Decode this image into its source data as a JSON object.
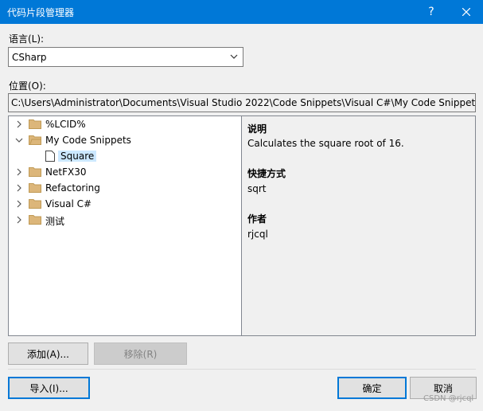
{
  "window": {
    "title": "代码片段管理器",
    "help_glyph": "?",
    "close_icon": "close-icon"
  },
  "language": {
    "label": "语言(L):",
    "selected": "CSharp"
  },
  "location": {
    "label": "位置(O):",
    "path": "C:\\Users\\Administrator\\Documents\\Visual Studio 2022\\Code Snippets\\Visual C#\\My Code Snippets\\"
  },
  "tree": {
    "items": [
      {
        "label": "%LCID%",
        "level": 0,
        "expanded": false,
        "type": "folder"
      },
      {
        "label": "My Code Snippets",
        "level": 0,
        "expanded": true,
        "type": "folder"
      },
      {
        "label": "Square",
        "level": 1,
        "type": "snippet",
        "selected": true
      },
      {
        "label": "NetFX30",
        "level": 0,
        "expanded": false,
        "type": "folder"
      },
      {
        "label": "Refactoring",
        "level": 0,
        "expanded": false,
        "type": "folder"
      },
      {
        "label": "Visual C#",
        "level": 0,
        "expanded": false,
        "type": "folder"
      },
      {
        "label": "测试",
        "level": 0,
        "expanded": false,
        "type": "folder"
      }
    ]
  },
  "details": {
    "description_label": "说明",
    "description": "Calculates the square root of 16.",
    "shortcut_label": "快捷方式",
    "shortcut": "sqrt",
    "author_label": "作者",
    "author": "rjcql"
  },
  "buttons": {
    "add": "添加(A)...",
    "remove": "移除(R)",
    "import": "导入(I)...",
    "ok": "确定",
    "cancel": "取消"
  },
  "watermark": "CSDN @rjcql",
  "colors": {
    "titlebar": "#0078d7",
    "selection": "#cce8ff",
    "folder": "#dcb67a"
  }
}
